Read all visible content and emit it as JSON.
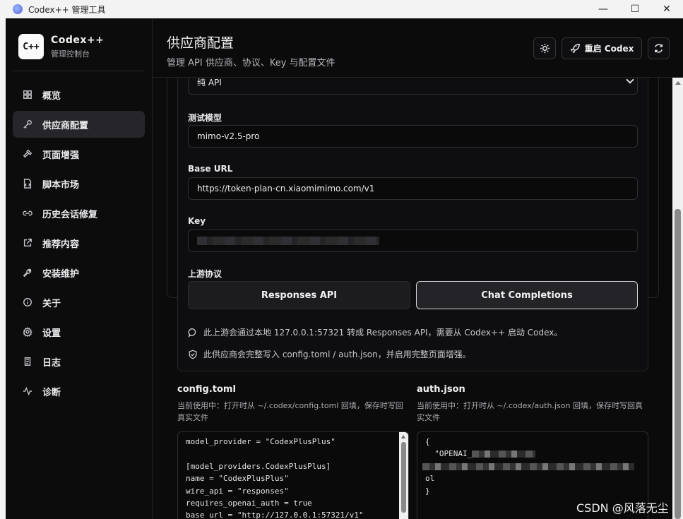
{
  "window": {
    "title": "Codex++ 管理工具",
    "controls": {
      "minimize": "—",
      "maximize": "☐",
      "close": "✕"
    }
  },
  "brand": {
    "logo": "C++",
    "name": "Codex++",
    "subtitle": "管理控制台"
  },
  "sidebar": {
    "items": [
      {
        "label": "概览",
        "icon": "grid-icon",
        "active": false
      },
      {
        "label": "供应商配置",
        "icon": "key-icon",
        "active": true
      },
      {
        "label": "页面增强",
        "icon": "hammer-icon",
        "active": false
      },
      {
        "label": "脚本市场",
        "icon": "file-code-icon",
        "active": false
      },
      {
        "label": "历史会话修复",
        "icon": "link-icon",
        "active": false
      },
      {
        "label": "推荐内容",
        "icon": "external-link-icon",
        "active": false
      },
      {
        "label": "安装维护",
        "icon": "wrench-icon",
        "active": false
      },
      {
        "label": "关于",
        "icon": "info-icon",
        "active": false
      },
      {
        "label": "设置",
        "icon": "gear-icon",
        "active": false
      },
      {
        "label": "日志",
        "icon": "scroll-icon",
        "active": false
      },
      {
        "label": "诊断",
        "icon": "activity-icon",
        "active": false
      }
    ]
  },
  "header": {
    "title": "供应商配置",
    "subtitle": "管理 API 供应商、协议、Key 与配置文件",
    "restart_label": "重启 Codex"
  },
  "form": {
    "mode_value": "纯 API",
    "test_model": {
      "label": "测试模型",
      "value": "mimo-v2.5-pro"
    },
    "base_url": {
      "label": "Base URL",
      "value": "https://token-plan-cn.xiaomimimo.com/v1"
    },
    "key": {
      "label": "Key"
    },
    "protocol": {
      "label": "上游协议",
      "options": [
        "Responses API",
        "Chat Completions"
      ],
      "selected": "Chat Completions"
    },
    "notes": [
      "此上游会通过本地 127.0.0.1:57321 转成 Responses API，需要从 Codex++ 启动 Codex。",
      "此供应商会完整写入 config.toml / auth.json，并启用完整页面增强。"
    ]
  },
  "config_toml": {
    "title": "config.toml",
    "desc": "当前使用中：打开时从 ~/.codex/config.toml 回填，保存时写回真实文件",
    "lines": [
      "model_provider = \"CodexPlusPlus\"",
      "",
      "[model_providers.CodexPlusPlus]",
      "name = \"CodexPlusPlus\"",
      "wire_api = \"responses\"",
      "requires_openai_auth = true",
      "base_url = \"http://127.0.0.1:57321/v1\""
    ]
  },
  "auth_json": {
    "title": "auth.json",
    "desc": "当前使用中：打开时从 ~/.codex/auth.json 回填，保存时写回真实文件",
    "line_open": "{",
    "line_key": "  \"OPENAI_",
    "line_close": "}",
    "line_tail": "ol"
  },
  "watermark": "CSDN @风落无尘"
}
